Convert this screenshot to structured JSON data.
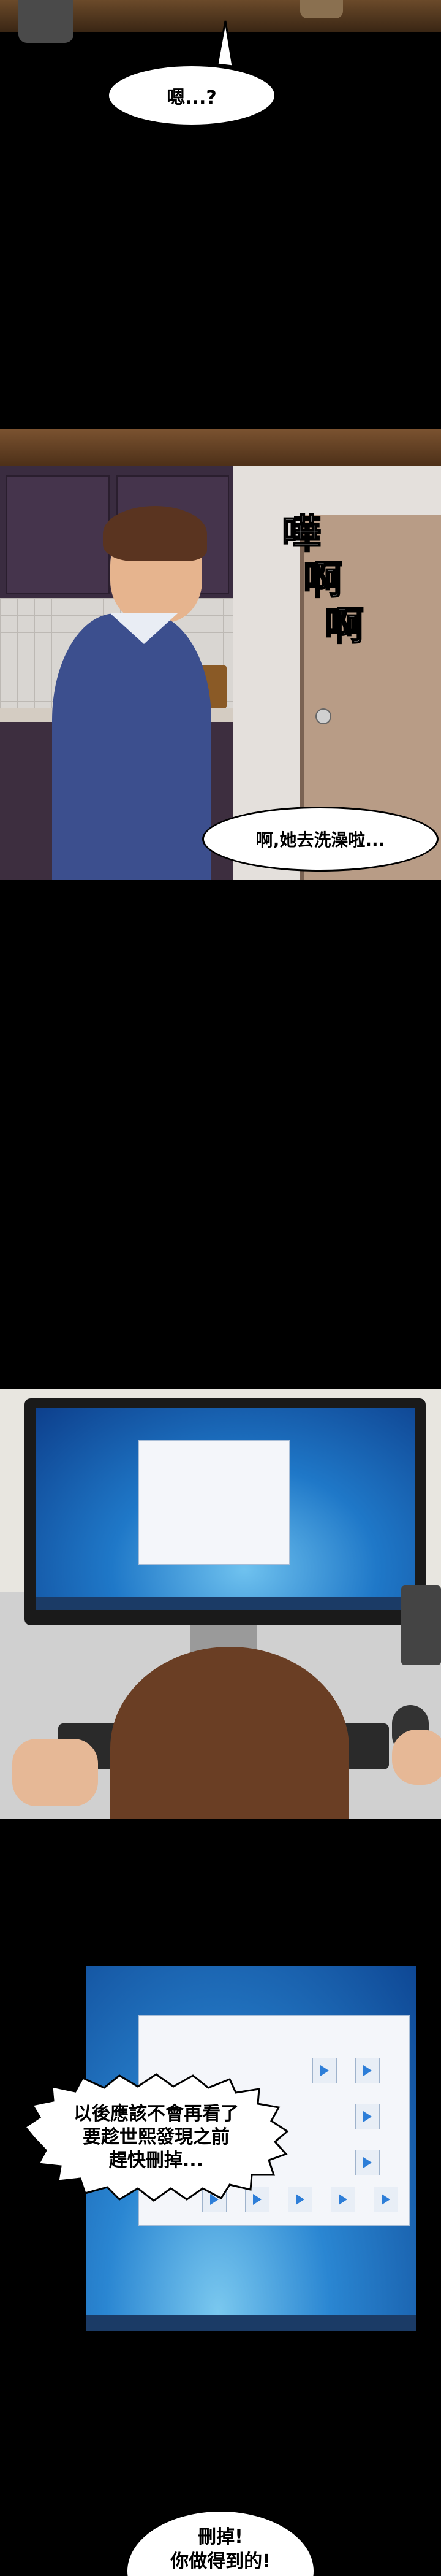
{
  "speech": {
    "b1": "嗯...?",
    "b2": "啊,她去洗澡啦...",
    "b3": "以後應該不會再看了\n要趁世熙發現之前\n趕快刪掉...",
    "b4": "刪掉!\n你做得到的!"
  },
  "sfx": {
    "shower": [
      "嘩",
      "啊",
      "啊"
    ]
  },
  "icons": {
    "monitor": "monitor-icon",
    "keyboard": "keyboard-icon",
    "mouse": "mouse-icon",
    "video_file": "video-file-icon"
  }
}
